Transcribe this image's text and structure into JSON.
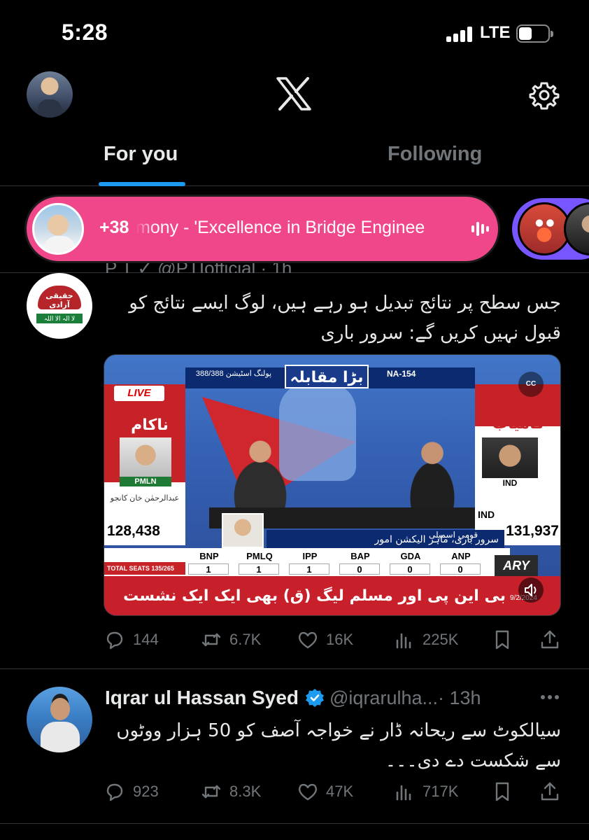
{
  "status_bar": {
    "time": "5:28",
    "network": "LTE",
    "battery_level": 0.45
  },
  "header": {
    "logo_icon": "x-logo-icon",
    "settings_icon": "gear-icon",
    "tabs": [
      {
        "label": "For you",
        "active": true
      },
      {
        "label": "Following",
        "active": false
      }
    ],
    "accent_color": "#1d9bf0"
  },
  "spaces": {
    "count": "+38",
    "title": "mony - 'Excellence in Bridge Enginee",
    "pill_color": "#f0468a",
    "next_color": "#7856ff"
  },
  "tweets": [
    {
      "avatar_text_top": "حقیقی آزادی",
      "avatar_text_bottom": "لا الہ الا اللہ",
      "header_cut": "P T ✓ @PTIofficial · 1h",
      "text": "جس سطح پر نتائج تبدیل ہو رہے ہیں، لوگ ایسے نتائج کو قبول نہیں کریں گے: سرور باری",
      "media": {
        "live_label": "LIVE",
        "left_status": "ناکام",
        "left_party": "PMLN",
        "left_name": "عبدالرحمٰن خان کانجو",
        "left_votes": "128,438",
        "right_status": "کامیاب",
        "right_party": "IND",
        "right_party2": "IND",
        "right_votes": "131,937",
        "station_label": "پولنگ اسٹیشن 388/388",
        "headline": "بڑا مقابلہ",
        "constituency": "NA-154",
        "guest_caption": "سرور باری، ماہر الیکشن امور",
        "assembly_label": "قومی اسمبلی",
        "total_seats": "TOTAL SEATS 135/265",
        "parties": [
          {
            "name": "BNP",
            "seats": "1"
          },
          {
            "name": "PMLQ",
            "seats": "1"
          },
          {
            "name": "IPP",
            "seats": "1"
          },
          {
            "name": "BAP",
            "seats": "0"
          },
          {
            "name": "GDA",
            "seats": "0"
          },
          {
            "name": "ANP",
            "seats": "0"
          }
        ],
        "ticker": "بی این پی اور مسلم لیگ (ق) بھی ایک ایک نشست پر کامیاب",
        "channel": "ARY",
        "date": "9/2/2024",
        "cc_label": "CC"
      },
      "stats": {
        "replies": "144",
        "reposts": "6.7K",
        "likes": "16K",
        "views": "225K"
      }
    },
    {
      "name": "Iqrar ul Hassan Syed",
      "handle": "@iqrarulha...",
      "time": "· 13h",
      "text": "سیالکوٹ سے ریحانہ ڈار نے خواجہ آصف کو 50 ہزار ووٹوں سے شکست دے دی۔۔۔",
      "stats": {
        "replies": "923",
        "reposts": "8.3K",
        "likes": "47K",
        "views": "717K"
      }
    }
  ]
}
